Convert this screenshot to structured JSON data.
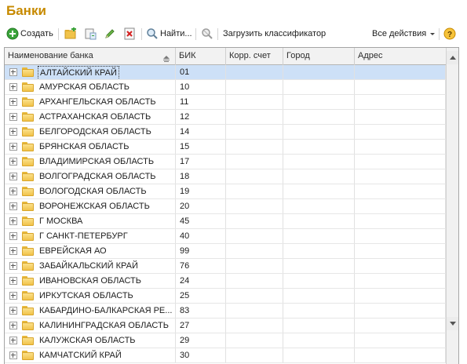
{
  "page": {
    "title": "Банки"
  },
  "toolbar": {
    "create_label": "Создать",
    "find_label": "Найти...",
    "load_label": "Загрузить классификатор",
    "all_actions_label": "Все действия",
    "colors": {
      "accent": "#c78a00",
      "create_green": "#3aa33a",
      "delete_red": "#d42020"
    }
  },
  "table": {
    "columns": [
      "Наименование банка",
      "БИК",
      "Корр. счет",
      "Город",
      "Адрес"
    ],
    "selected_index": 0,
    "rows": [
      {
        "name": "АЛТАЙСКИЙ КРАЙ",
        "bik": "01",
        "corr": "",
        "city": "",
        "address": ""
      },
      {
        "name": "АМУРСКАЯ ОБЛАСТЬ",
        "bik": "10",
        "corr": "",
        "city": "",
        "address": ""
      },
      {
        "name": "АРХАНГЕЛЬСКАЯ ОБЛАСТЬ",
        "bik": "11",
        "corr": "",
        "city": "",
        "address": ""
      },
      {
        "name": "АСТРАХАНСКАЯ ОБЛАСТЬ",
        "bik": "12",
        "corr": "",
        "city": "",
        "address": ""
      },
      {
        "name": "БЕЛГОРОДСКАЯ ОБЛАСТЬ",
        "bik": "14",
        "corr": "",
        "city": "",
        "address": ""
      },
      {
        "name": "БРЯНСКАЯ ОБЛАСТЬ",
        "bik": "15",
        "corr": "",
        "city": "",
        "address": ""
      },
      {
        "name": "ВЛАДИМИРСКАЯ ОБЛАСТЬ",
        "bik": "17",
        "corr": "",
        "city": "",
        "address": ""
      },
      {
        "name": "ВОЛГОГРАДСКАЯ ОБЛАСТЬ",
        "bik": "18",
        "corr": "",
        "city": "",
        "address": ""
      },
      {
        "name": "ВОЛОГОДСКАЯ ОБЛАСТЬ",
        "bik": "19",
        "corr": "",
        "city": "",
        "address": ""
      },
      {
        "name": "ВОРОНЕЖСКАЯ ОБЛАСТЬ",
        "bik": "20",
        "corr": "",
        "city": "",
        "address": ""
      },
      {
        "name": "Г МОСКВА",
        "bik": "45",
        "corr": "",
        "city": "",
        "address": ""
      },
      {
        "name": "Г САНКТ-ПЕТЕРБУРГ",
        "bik": "40",
        "corr": "",
        "city": "",
        "address": ""
      },
      {
        "name": "ЕВРЕЙСКАЯ АО",
        "bik": "99",
        "corr": "",
        "city": "",
        "address": ""
      },
      {
        "name": "ЗАБАЙКАЛЬСКИЙ КРАЙ",
        "bik": "76",
        "corr": "",
        "city": "",
        "address": ""
      },
      {
        "name": "ИВАНОВСКАЯ ОБЛАСТЬ",
        "bik": "24",
        "corr": "",
        "city": "",
        "address": ""
      },
      {
        "name": "ИРКУТСКАЯ ОБЛАСТЬ",
        "bik": "25",
        "corr": "",
        "city": "",
        "address": ""
      },
      {
        "name": "КАБАРДИНО-БАЛКАРСКАЯ РЕ...",
        "bik": "83",
        "corr": "",
        "city": "",
        "address": ""
      },
      {
        "name": "КАЛИНИНГРАДСКАЯ ОБЛАСТЬ",
        "bik": "27",
        "corr": "",
        "city": "",
        "address": ""
      },
      {
        "name": "КАЛУЖСКАЯ ОБЛАСТЬ",
        "bik": "29",
        "corr": "",
        "city": "",
        "address": ""
      },
      {
        "name": "КАМЧАТСКИЙ КРАЙ",
        "bik": "30",
        "corr": "",
        "city": "",
        "address": ""
      }
    ]
  }
}
